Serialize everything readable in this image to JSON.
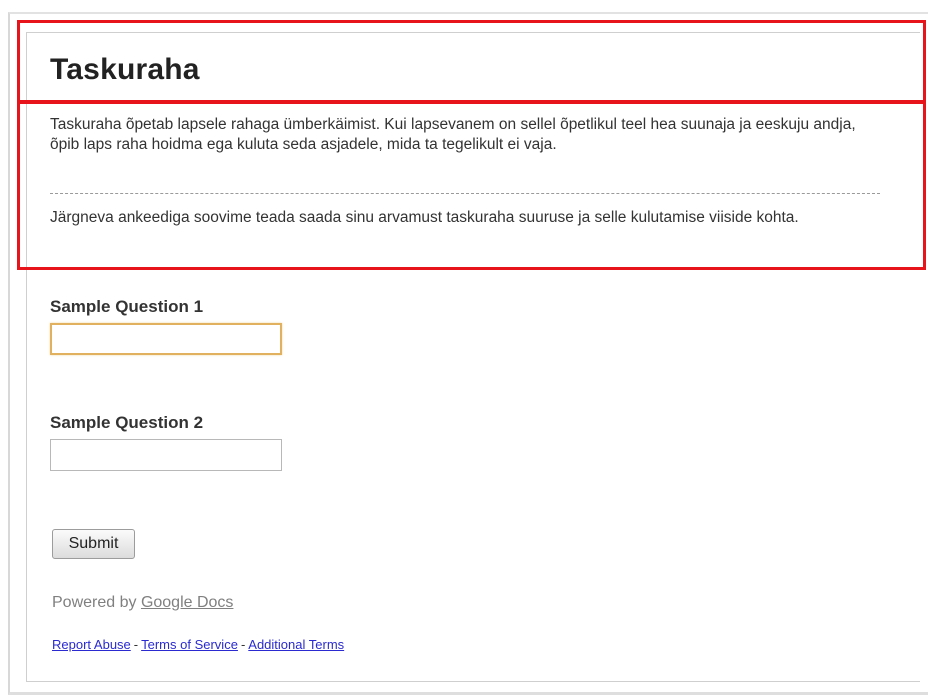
{
  "form": {
    "title": "Taskuraha",
    "description": "Taskuraha õpetab lapsele rahaga ümberkäimist. Kui lapsevanem on sellel õpetlikul teel hea suunaja ja eeskuju andja, õpib laps raha hoidma ega kuluta seda asjadele, mida ta tegelikult ei vaja.",
    "description_2": "Järgneva ankeediga soovime teada saada sinu arvamust taskuraha suuruse ja selle kulutamise viiside kohta.",
    "questions": [
      {
        "label": "Sample Question 1",
        "value": ""
      },
      {
        "label": "Sample Question 2",
        "value": ""
      }
    ],
    "submit_label": "Submit"
  },
  "footer": {
    "powered_by_prefix": "Powered by ",
    "powered_by_link": "Google Docs",
    "links": [
      {
        "label": "Report Abuse"
      },
      {
        "label": "Terms of Service"
      },
      {
        "label": "Additional Terms"
      }
    ],
    "separator": "-"
  },
  "colors": {
    "highlight": "#e8141b",
    "focus_border": "#e2b15f",
    "link": "#2a2ad0"
  }
}
